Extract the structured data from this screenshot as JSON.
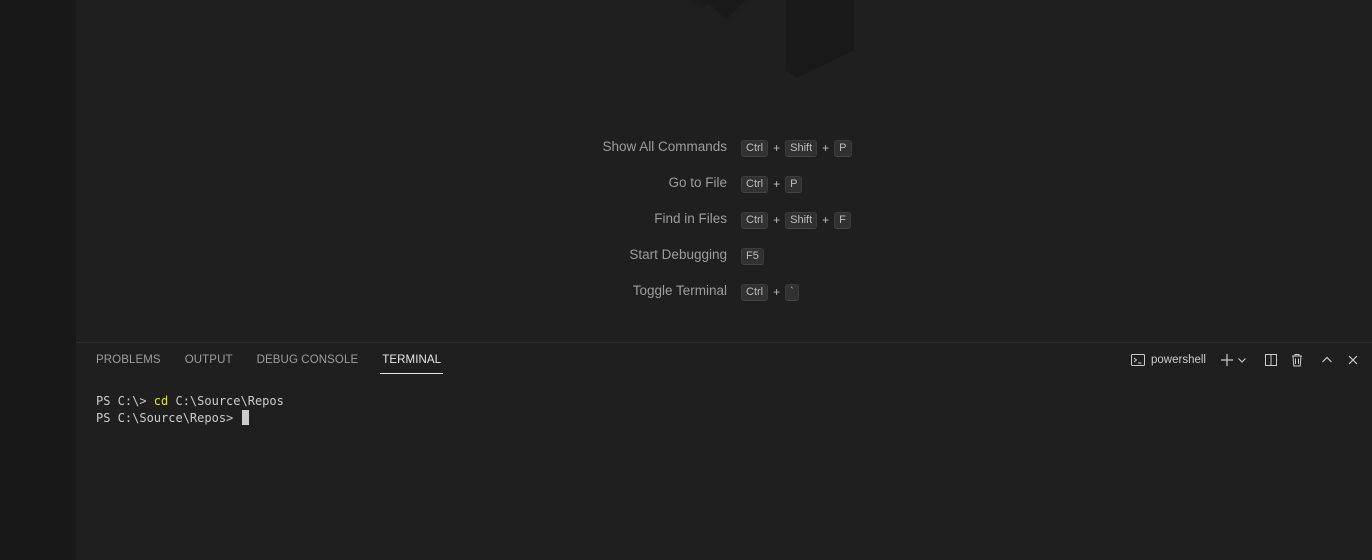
{
  "shortcuts": [
    {
      "label": "Show All Commands",
      "keys": [
        "Ctrl",
        "Shift",
        "P"
      ]
    },
    {
      "label": "Go to File",
      "keys": [
        "Ctrl",
        "P"
      ]
    },
    {
      "label": "Find in Files",
      "keys": [
        "Ctrl",
        "Shift",
        "F"
      ]
    },
    {
      "label": "Start Debugging",
      "keys": [
        "F5"
      ]
    },
    {
      "label": "Toggle Terminal",
      "keys": [
        "Ctrl",
        "`"
      ]
    }
  ],
  "panel": {
    "tabs": [
      "PROBLEMS",
      "OUTPUT",
      "DEBUG CONSOLE",
      "TERMINAL"
    ],
    "active_tab": "TERMINAL",
    "terminal_name": "powershell",
    "icons": [
      "terminal-icon",
      "plus-icon",
      "chevron-down-icon",
      "split-icon",
      "trash-icon",
      "chevron-up-icon",
      "close-icon"
    ]
  },
  "terminal": {
    "line1_prompt": "PS C:\\> ",
    "line1_cmd": "cd",
    "line1_arg": " C:\\Source\\Repos",
    "line2_prompt": "PS C:\\Source\\Repos> "
  },
  "colors": {
    "background": "#1f1f1f",
    "activity_bar": "#181818",
    "command_yellow": "#e5e510"
  }
}
